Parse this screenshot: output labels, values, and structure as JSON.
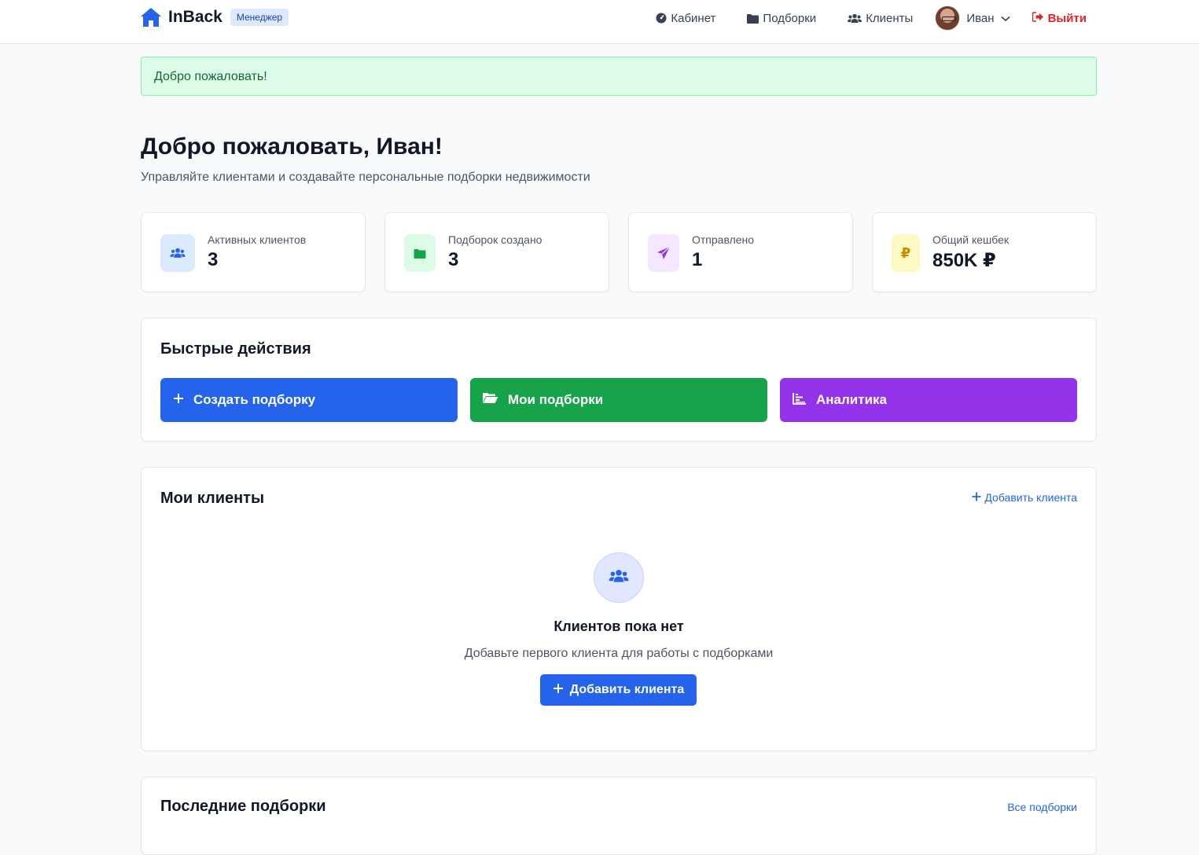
{
  "header": {
    "brand": "InBack",
    "role_badge": "Менеджер",
    "nav": {
      "cabinet": "Кабинет",
      "collections": "Подборки",
      "clients": "Клиенты"
    },
    "user_name": "Иван",
    "logout": "Выйти"
  },
  "alert": {
    "text": "Добро пожаловать!"
  },
  "page": {
    "title": "Добро пожаловать, Иван!",
    "subtitle": "Управляйте клиентами и создавайте персональные подборки недвижимости"
  },
  "stats": [
    {
      "label": "Активных клиентов",
      "value": "3",
      "icon": "users-icon",
      "icon_color": "#2563eb",
      "bg": "#dbeafe"
    },
    {
      "label": "Подборок создано",
      "value": "3",
      "icon": "folder-icon",
      "icon_color": "#16a34a",
      "bg": "#dcfce7"
    },
    {
      "label": "Отправлено",
      "value": "1",
      "icon": "paper-plane-icon",
      "icon_color": "#9333ea",
      "bg": "#f3e8ff"
    },
    {
      "label": "Общий кешбек",
      "value": "850K ₽",
      "icon": "ruble-icon",
      "icon_color": "#ca8a04",
      "bg": "#fef9c3"
    }
  ],
  "quick_actions": {
    "title": "Быстрые действия",
    "buttons": [
      {
        "label": "Создать подборку",
        "color": "#2563eb",
        "icon": "plus-icon"
      },
      {
        "label": "Мои подборки",
        "color": "#16a34a",
        "icon": "folder-open-icon"
      },
      {
        "label": "Аналитика",
        "color": "#9333ea",
        "icon": "chart-icon"
      }
    ]
  },
  "clients": {
    "title": "Мои клиенты",
    "add_link": "Добавить клиента",
    "empty_title": "Клиентов пока нет",
    "empty_subtitle": "Добавьте первого клиента для работы с подборками",
    "add_button": "Добавить клиента"
  },
  "recent": {
    "title": "Последние подборки",
    "all_link": "Все подборки"
  }
}
